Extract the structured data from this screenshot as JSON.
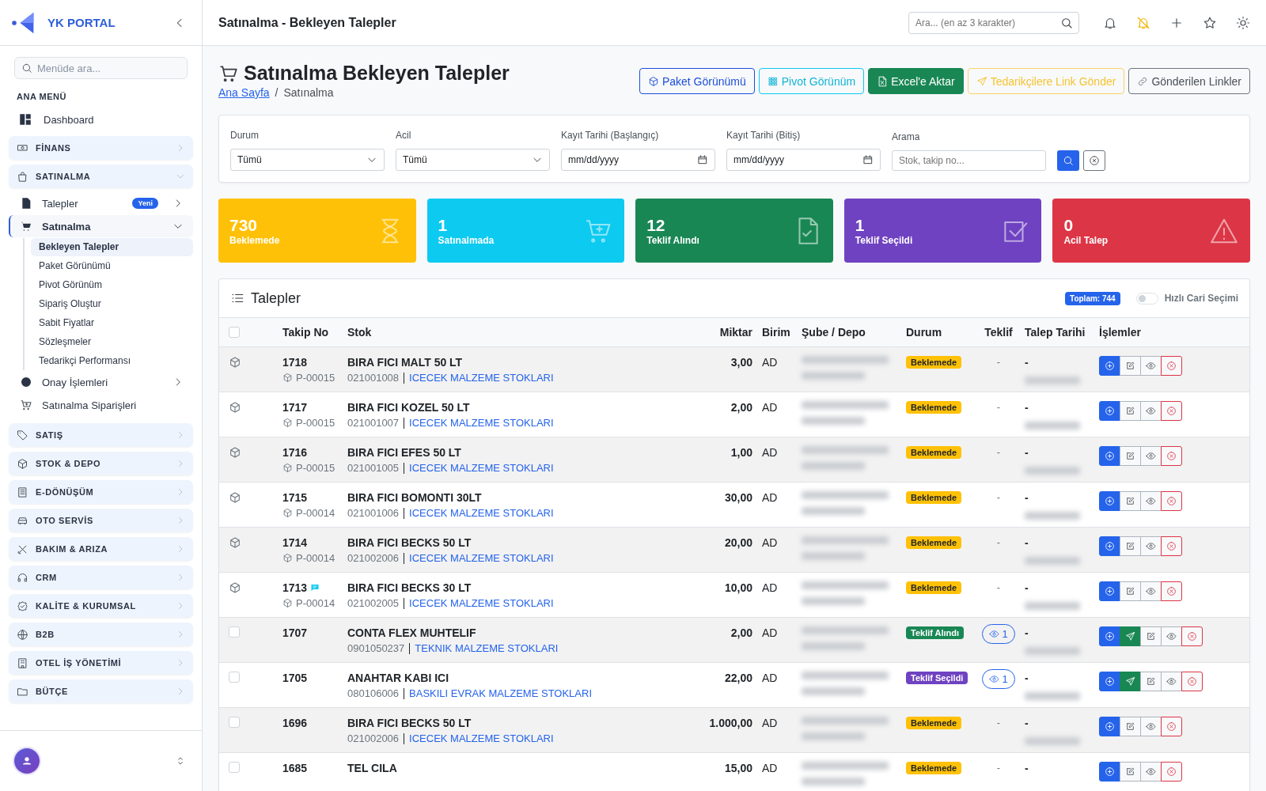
{
  "sidebar": {
    "brand": "YK PORTAL",
    "search": {
      "placeholder": "Menüde ara..."
    },
    "section": "ANA MENÜ",
    "items": [
      {
        "kind": "link",
        "label": "Dashboard"
      },
      {
        "kind": "group",
        "label": "FİNANS",
        "expanded": false
      },
      {
        "kind": "group",
        "label": "SATINALMA",
        "expanded": true,
        "children": [
          {
            "kind": "submenu",
            "label": "Talepler",
            "badge": "Yeni",
            "expanded": false,
            "active": false
          },
          {
            "kind": "submenu",
            "label": "Satınalma",
            "expanded": true,
            "active": true,
            "children": [
              {
                "label": "Bekleyen Talepler",
                "selected": true
              },
              {
                "label": "Paket Görünümü",
                "selected": false
              },
              {
                "label": "Pivot Görünüm",
                "selected": false
              },
              {
                "label": "Sipariş Oluştur",
                "selected": false
              },
              {
                "label": "Sabit Fiyatlar",
                "selected": false
              },
              {
                "label": "Sözleşmeler",
                "selected": false
              },
              {
                "label": "Tedarikçi Performansı",
                "selected": false
              }
            ]
          },
          {
            "kind": "submenu",
            "label": "Onay İşlemleri",
            "expanded": false,
            "active": false
          },
          {
            "kind": "link",
            "label": "Satınalma Siparişleri",
            "active": false
          }
        ]
      },
      {
        "kind": "group",
        "label": "SATIŞ",
        "expanded": false
      },
      {
        "kind": "group",
        "label": "STOK & DEPO",
        "expanded": false
      },
      {
        "kind": "group",
        "label": "E-DÖNÜŞÜM",
        "expanded": false
      },
      {
        "kind": "group",
        "label": "OTO SERVİS",
        "expanded": false
      },
      {
        "kind": "group",
        "label": "BAKIM & ARIZA",
        "expanded": false
      },
      {
        "kind": "group",
        "label": "CRM",
        "expanded": false
      },
      {
        "kind": "group",
        "label": "KALİTE & KURUMSAL",
        "expanded": false
      },
      {
        "kind": "group",
        "label": "B2B",
        "expanded": false
      },
      {
        "kind": "group",
        "label": "OTEL İŞ YÖNETİMİ",
        "expanded": false
      },
      {
        "kind": "group",
        "label": "BÜTÇE",
        "expanded": false
      }
    ]
  },
  "topbar": {
    "title": "Satınalma - Bekleyen Talepler",
    "search": {
      "placeholder": "Ara... (en az 3 karakter)"
    }
  },
  "page": {
    "title": "Satınalma Bekleyen Talepler",
    "breadcrumb": [
      {
        "label": "Ana Sayfa",
        "kind": "link"
      },
      {
        "label": "Satınalma",
        "kind": "current"
      }
    ],
    "separator": "/",
    "buttons": [
      {
        "label": "Paket Görünümü",
        "kind": "outline-primary"
      },
      {
        "label": "Pivot Görünüm",
        "kind": "outline-info"
      },
      {
        "label": "Excel'e Aktar",
        "kind": "success"
      },
      {
        "label": "Tedarikçilere Link Gönder",
        "kind": "outline-warning"
      },
      {
        "label": "Gönderilen Linkler",
        "kind": "outline-secondary"
      }
    ]
  },
  "filters": [
    {
      "kind": "select",
      "label": "Durum",
      "value": "Tümü"
    },
    {
      "kind": "select",
      "label": "Acil",
      "value": "Tümü"
    },
    {
      "kind": "date",
      "label": "Kayıt Tarihi (Başlangıç)",
      "value": "mm/dd/yyyy"
    },
    {
      "kind": "date",
      "label": "Kayıt Tarihi (Bitiş)",
      "value": "mm/dd/yyyy"
    },
    {
      "kind": "text",
      "label": "Arama",
      "placeholder": "Stok, takip no..."
    }
  ],
  "stats": [
    {
      "value": "730",
      "label": "Beklemede",
      "color": "#ffc107"
    },
    {
      "value": "1",
      "label": "Satınalmada",
      "color": "#0dcaf0"
    },
    {
      "value": "12",
      "label": "Teklif Alındı",
      "color": "#198754"
    },
    {
      "value": "1",
      "label": "Teklif Seçildi",
      "color": "#6f42c1"
    },
    {
      "value": "0",
      "label": "Acil Talep",
      "color": "#dc3545"
    }
  ],
  "table": {
    "title": "Talepler",
    "total": "Toplam: 744",
    "toggle": {
      "label": "Hızlı Cari Seçimi",
      "on": false
    },
    "select_all": {
      "checked": false
    },
    "columns": [
      "Takip No",
      "Stok",
      "Miktar",
      "Birim",
      "Şube / Depo",
      "Durum",
      "Teklif",
      "Talep Tarihi",
      "İşlemler"
    ],
    "rows": [
      {
        "kind": "package",
        "takip": "1718",
        "note": false,
        "package": "P-00015",
        "stock": "BIRA FICI MALT 50 LT",
        "code": "021001008",
        "group": "ICECEK MALZEME STOKLARI",
        "qty": "3,00",
        "unit": "AD",
        "status": {
          "label": "Beklemede",
          "kind": "waiting"
        },
        "offer": {
          "kind": "none",
          "label": "-"
        },
        "date": "-",
        "send": false
      },
      {
        "kind": "package",
        "takip": "1717",
        "note": false,
        "package": "P-00015",
        "stock": "BIRA FICI KOZEL 50 LT",
        "code": "021001007",
        "group": "ICECEK MALZEME STOKLARI",
        "qty": "2,00",
        "unit": "AD",
        "status": {
          "label": "Beklemede",
          "kind": "waiting"
        },
        "offer": {
          "kind": "none",
          "label": "-"
        },
        "date": "-",
        "send": false
      },
      {
        "kind": "package",
        "takip": "1716",
        "note": false,
        "package": "P-00015",
        "stock": "BIRA FICI EFES 50 LT",
        "code": "021001005",
        "group": "ICECEK MALZEME STOKLARI",
        "qty": "1,00",
        "unit": "AD",
        "status": {
          "label": "Beklemede",
          "kind": "waiting"
        },
        "offer": {
          "kind": "none",
          "label": "-"
        },
        "date": "-",
        "send": false
      },
      {
        "kind": "package",
        "takip": "1715",
        "note": false,
        "package": "P-00014",
        "stock": "BIRA FICI BOMONTI 30LT",
        "code": "021001006",
        "group": "ICECEK MALZEME STOKLARI",
        "qty": "30,00",
        "unit": "AD",
        "status": {
          "label": "Beklemede",
          "kind": "waiting"
        },
        "offer": {
          "kind": "none",
          "label": "-"
        },
        "date": "-",
        "send": false
      },
      {
        "kind": "package",
        "takip": "1714",
        "note": false,
        "package": "P-00014",
        "stock": "BIRA FICI BECKS 50 LT",
        "code": "021002006",
        "group": "ICECEK MALZEME STOKLARI",
        "qty": "20,00",
        "unit": "AD",
        "status": {
          "label": "Beklemede",
          "kind": "waiting"
        },
        "offer": {
          "kind": "none",
          "label": "-"
        },
        "date": "-",
        "send": false
      },
      {
        "kind": "package",
        "takip": "1713",
        "note": true,
        "package": "P-00014",
        "stock": "BIRA FICI BECKS 30 LT",
        "code": "021002005",
        "group": "ICECEK MALZEME STOKLARI",
        "qty": "10,00",
        "unit": "AD",
        "status": {
          "label": "Beklemede",
          "kind": "waiting"
        },
        "offer": {
          "kind": "none",
          "label": "-"
        },
        "date": "-",
        "send": false
      },
      {
        "kind": "checkbox",
        "checked": false,
        "takip": "1707",
        "note": false,
        "stock": "CONTA FLEX MUHTELIF",
        "code": "0901050237",
        "group": "TEKNIK MALZEME STOKLARI",
        "qty": "2,00",
        "unit": "AD",
        "status": {
          "label": "Teklif Alındı",
          "kind": "received"
        },
        "offer": {
          "kind": "count",
          "label": "1"
        },
        "date": "-",
        "send": true
      },
      {
        "kind": "checkbox",
        "checked": false,
        "takip": "1705",
        "note": false,
        "stock": "ANAHTAR KABI ICI",
        "code": "080106006",
        "group": "BASKILI EVRAK MALZEME STOKLARI",
        "qty": "22,00",
        "unit": "AD",
        "status": {
          "label": "Teklif Seçildi",
          "kind": "selected"
        },
        "offer": {
          "kind": "count",
          "label": "1"
        },
        "date": "-",
        "send": true
      },
      {
        "kind": "checkbox",
        "checked": false,
        "takip": "1696",
        "note": false,
        "stock": "BIRA FICI BECKS 50 LT",
        "code": "021002006",
        "group": "ICECEK MALZEME STOKLARI",
        "qty": "1.000,00",
        "unit": "AD",
        "status": {
          "label": "Beklemede",
          "kind": "waiting"
        },
        "offer": {
          "kind": "none",
          "label": "-"
        },
        "date": "-",
        "send": false
      },
      {
        "kind": "checkbox",
        "checked": false,
        "takip": "1685",
        "note": false,
        "stock": "TEL CILA",
        "qty": "15,00",
        "unit": "AD",
        "status": {
          "label": "Beklemede",
          "kind": "waiting"
        },
        "offer": {
          "kind": "none",
          "label": "-"
        },
        "date": "-",
        "send": false
      }
    ]
  }
}
